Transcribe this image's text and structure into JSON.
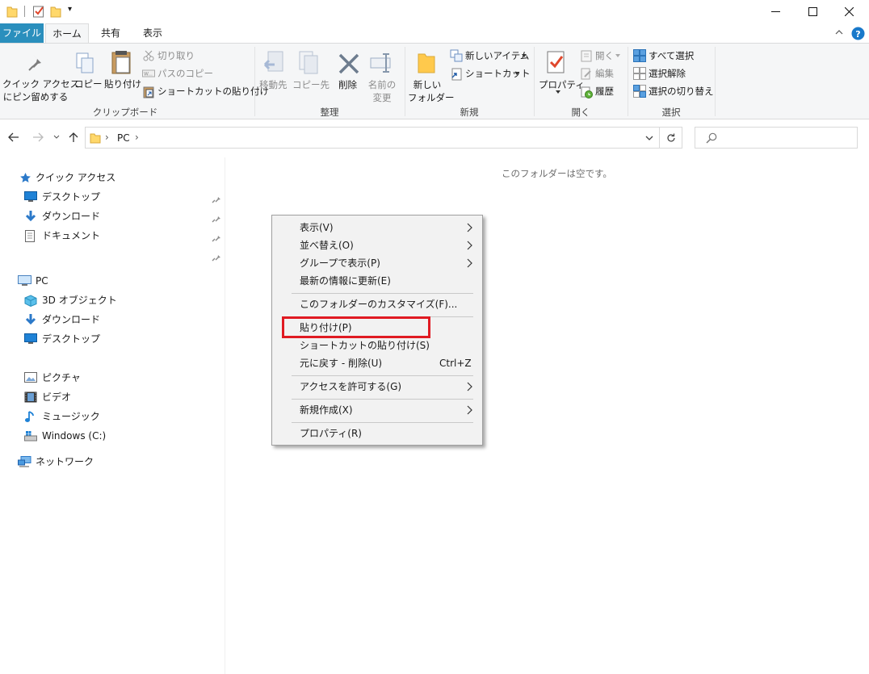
{
  "titlebar": {
    "qat_dropdown": "▾",
    "controls": {
      "minimize": "—",
      "maximize": "☐",
      "close": "✕"
    }
  },
  "tabs": [
    {
      "label": "ファイル"
    },
    {
      "label": "ホーム"
    },
    {
      "label": "共有"
    },
    {
      "label": "表示"
    }
  ],
  "ribbon": {
    "clipboard": {
      "pin_label_1": "クイック アクセス",
      "pin_label_2": "にピン留めする",
      "copy": "コピー",
      "paste": "貼り付け",
      "cut": "切り取り",
      "copy_path": "パスのコピー",
      "paste_shortcut": "ショートカットの貼り付け",
      "group": "クリップボード"
    },
    "organize": {
      "move_to": "移動先",
      "copy_to": "コピー先",
      "delete": "削除",
      "rename_1": "名前の",
      "rename_2": "変更",
      "group": "整理"
    },
    "new": {
      "new_folder_1": "新しい",
      "new_folder_2": "フォルダー",
      "new_item": "新しいアイテム",
      "shortcut": "ショートカット",
      "group": "新規"
    },
    "open": {
      "properties": "プロパティ",
      "open": "開く",
      "edit": "編集",
      "history": "履歴",
      "group": "開く"
    },
    "select": {
      "select_all": "すべて選択",
      "select_none": "選択解除",
      "invert": "選択の切り替え",
      "group": "選択"
    }
  },
  "address": {
    "path": [
      "PC"
    ],
    "separator": "›"
  },
  "navpane": {
    "quick_access": "クイック アクセス",
    "quick_items": [
      "デスクトップ",
      "ダウンロード",
      "ドキュメント"
    ],
    "pc": "PC",
    "pc_items": [
      "3D オブジェクト",
      "ダウンロード",
      "デスクトップ",
      "ピクチャ",
      "ビデオ",
      "ミュージック",
      "Windows (C:)"
    ],
    "network": "ネットワーク"
  },
  "content": {
    "empty_message": "このフォルダーは空です。"
  },
  "context_menu": {
    "items": [
      {
        "label": "表示(V)",
        "submenu": true
      },
      {
        "label": "並べ替え(O)",
        "submenu": true
      },
      {
        "label": "グループで表示(P)",
        "submenu": true
      },
      {
        "label": "最新の情報に更新(E)"
      },
      {
        "label": "このフォルダーのカスタマイズ(F)..."
      },
      {
        "label": "貼り付け(P)"
      },
      {
        "label": "ショートカットの貼り付け(S)"
      },
      {
        "label": "元に戻す - 削除(U)",
        "shortcut": "Ctrl+Z"
      },
      {
        "label": "アクセスを許可する(G)",
        "submenu": true
      },
      {
        "label": "新規作成(X)",
        "submenu": true
      },
      {
        "label": "プロパティ(R)"
      }
    ]
  },
  "colors": {
    "file_tab": "#2a8fbd",
    "highlight_box": "#e01a22",
    "help_icon": "#1979ca"
  }
}
